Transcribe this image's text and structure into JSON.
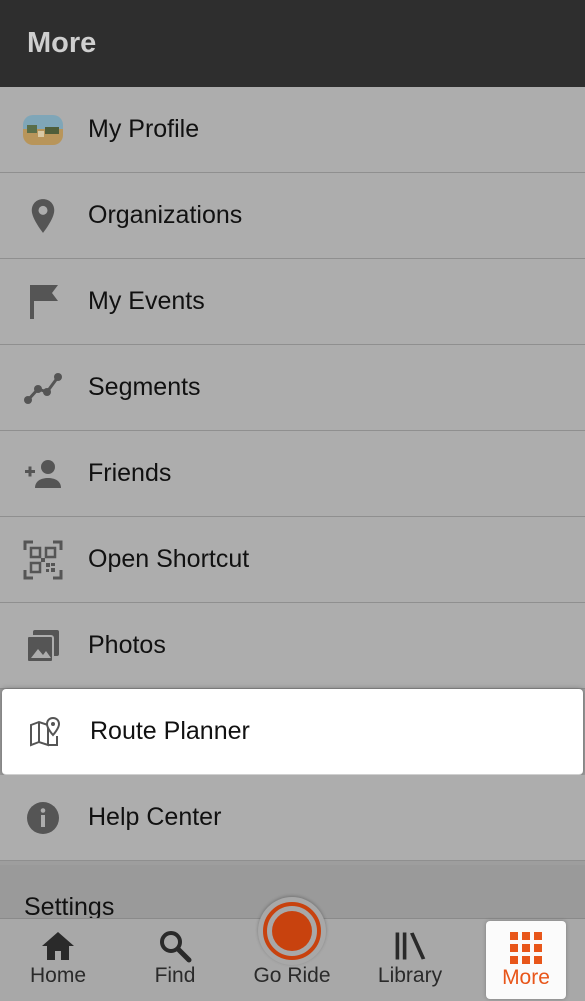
{
  "header": {
    "title": "More"
  },
  "menu": {
    "items": [
      {
        "label": "My Profile",
        "icon": "profile-avatar"
      },
      {
        "label": "Organizations",
        "icon": "location-pin-icon"
      },
      {
        "label": "My Events",
        "icon": "flag-icon"
      },
      {
        "label": "Segments",
        "icon": "segments-icon"
      },
      {
        "label": "Friends",
        "icon": "add-friend-icon"
      },
      {
        "label": "Open Shortcut",
        "icon": "qr-code-icon"
      },
      {
        "label": "Photos",
        "icon": "photos-icon"
      },
      {
        "label": "Route Planner",
        "icon": "map-pin-icon",
        "highlighted": true
      },
      {
        "label": "Help Center",
        "icon": "info-icon"
      }
    ],
    "settings_label": "Settings"
  },
  "tabbar": {
    "tabs": [
      {
        "label": "Home",
        "icon": "home-icon"
      },
      {
        "label": "Find",
        "icon": "search-icon"
      },
      {
        "label": "Go Ride",
        "icon": "record-icon"
      },
      {
        "label": "Library",
        "icon": "library-icon"
      },
      {
        "label": "More",
        "icon": "grid-icon",
        "active": true
      }
    ]
  },
  "colors": {
    "accent": "#e8561a",
    "record": "#c8420e",
    "header_bg": "#2e2e2e"
  }
}
